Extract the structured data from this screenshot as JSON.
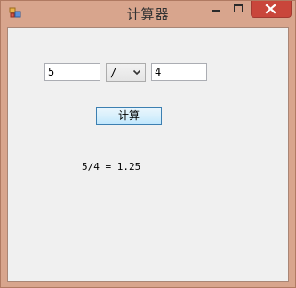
{
  "window": {
    "title": "计算器",
    "icon": "app-icon",
    "close_color": "#c9463b",
    "frame_color": "#d8a58d"
  },
  "controls": {
    "minimize_icon": "minimize-icon",
    "maximize_icon": "maximize-icon",
    "close_icon": "close-icon"
  },
  "form": {
    "operand1": "5",
    "operator": "/",
    "operator_icon": "chevron-down-icon",
    "operand2": "4",
    "calculate_label": "计算",
    "result": "5/4 = 1.25"
  }
}
